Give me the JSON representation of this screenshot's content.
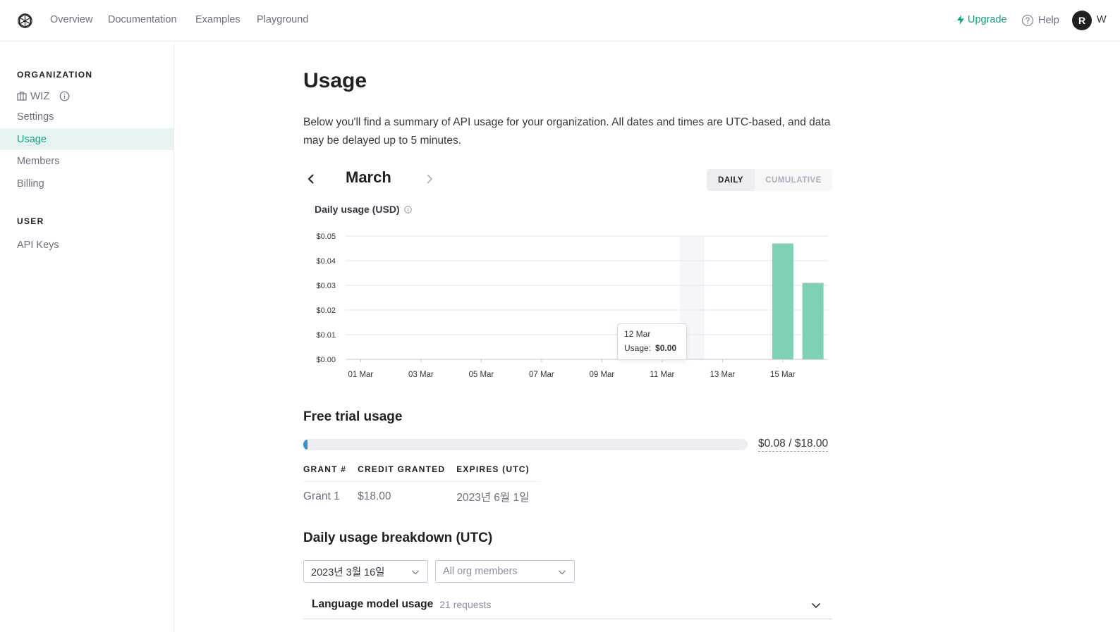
{
  "nav": {
    "links": [
      "Overview",
      "Documentation",
      "Examples",
      "Playground"
    ],
    "upgrade": "Upgrade",
    "help": "Help",
    "avatar_initial": "R",
    "account_name": "W"
  },
  "sidebar": {
    "org_heading": "ORGANIZATION",
    "org_name": "WIZ",
    "org_items": [
      {
        "label": "Settings",
        "active": false
      },
      {
        "label": "Usage",
        "active": true
      },
      {
        "label": "Members",
        "active": false
      },
      {
        "label": "Billing",
        "active": false
      }
    ],
    "user_heading": "USER",
    "user_items": [
      {
        "label": "API Keys",
        "active": false
      }
    ]
  },
  "page": {
    "title": "Usage",
    "intro": "Below you'll find a summary of API usage for your organization. All dates and times are UTC-based, and data may be delayed up to 5 minutes.",
    "month": "March",
    "toggle": {
      "daily": "DAILY",
      "cumulative": "CUMULATIVE",
      "selected": "daily"
    }
  },
  "chart_title": "Daily usage (USD)",
  "chart_data": {
    "type": "bar",
    "ylabel": "",
    "xlabel": "",
    "ylim": [
      0,
      0.05
    ],
    "ytick_labels": [
      "$0.00",
      "$0.01",
      "$0.02",
      "$0.03",
      "$0.04",
      "$0.05"
    ],
    "xtick_labels": [
      "01 Mar",
      "03 Mar",
      "05 Mar",
      "07 Mar",
      "09 Mar",
      "11 Mar",
      "13 Mar",
      "15 Mar"
    ],
    "categories": [
      "01 Mar",
      "02 Mar",
      "03 Mar",
      "04 Mar",
      "05 Mar",
      "06 Mar",
      "07 Mar",
      "08 Mar",
      "09 Mar",
      "10 Mar",
      "11 Mar",
      "12 Mar",
      "13 Mar",
      "14 Mar",
      "15 Mar",
      "16 Mar"
    ],
    "values": [
      0,
      0,
      0,
      0,
      0,
      0,
      0,
      0,
      0,
      0,
      0,
      0,
      0,
      0,
      0.047,
      0.031
    ],
    "highlighted": "12 Mar",
    "grid": true,
    "bar_color": "#7fd1b6"
  },
  "tooltip": {
    "date": "12 Mar",
    "label": "Usage:",
    "value": "$0.00"
  },
  "free_trial": {
    "heading": "Free trial usage",
    "used_fraction": 0.0044,
    "label": "$0.08 / $18.00",
    "headers": [
      "GRANT #",
      "CREDIT GRANTED",
      "EXPIRES (UTC)"
    ],
    "rows": [
      [
        "Grant 1",
        "$18.00",
        "2023년 6월 1일"
      ]
    ]
  },
  "breakdown": {
    "heading": "Daily usage breakdown (UTC)",
    "date_select": "2023년 3월 16일",
    "members_select": "All org members",
    "lm_title": "Language model usage",
    "lm_count": "21 requests"
  },
  "colors": {
    "accent": "#10a37f",
    "progress": "#2e95d3"
  }
}
